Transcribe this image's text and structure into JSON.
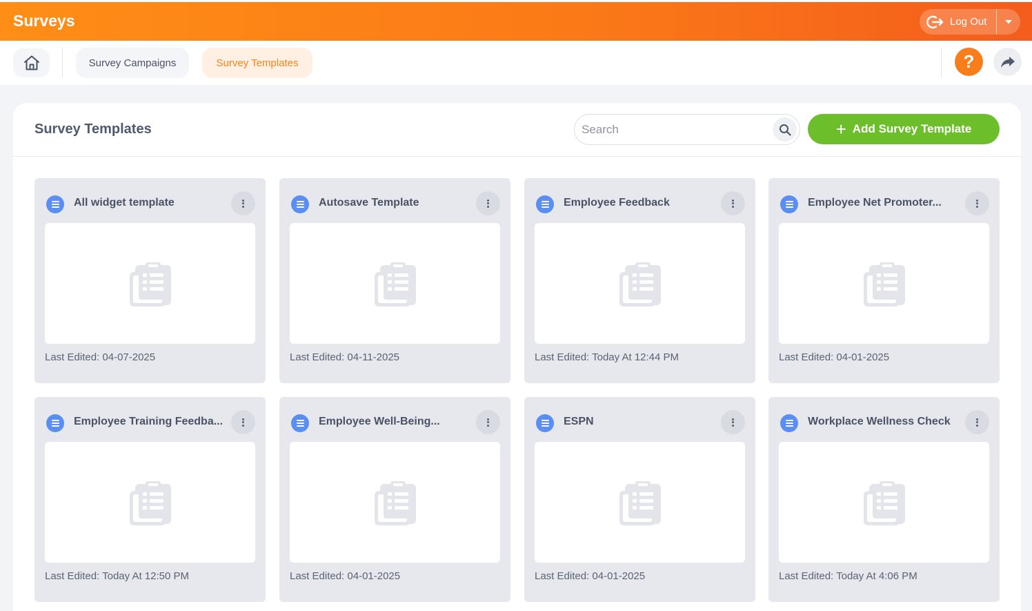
{
  "app": {
    "title": "Surveys",
    "logout_label": "Log Out",
    "icons": {
      "logout": "logout-icon",
      "caret": "caret-down-icon",
      "home": "home-icon",
      "help": "help-icon",
      "share": "share-icon",
      "search": "search-icon",
      "add": "plus-icon"
    },
    "colors": {
      "header_start": "#fe8e16",
      "header_end": "#f45d1c",
      "accent": "#f87e1c",
      "add_button": "#6cbf2b",
      "card_icon": "#5a8ef3"
    }
  },
  "nav": {
    "tabs": [
      {
        "label": "Survey Campaigns",
        "active": false
      },
      {
        "label": "Survey Templates",
        "active": true
      }
    ],
    "help_label": "?"
  },
  "main": {
    "title": "Survey Templates",
    "search_placeholder": "Search",
    "search_value": "",
    "add_label": "Add Survey Template"
  },
  "templates": [
    {
      "title": "All widget template",
      "last_edited": "Last Edited: 04-07-2025"
    },
    {
      "title": "Autosave Template",
      "last_edited": "Last Edited: 04-11-2025"
    },
    {
      "title": "Employee Feedback",
      "last_edited": "Last Edited: Today At 12:44 PM"
    },
    {
      "title": "Employee Net Promoter...",
      "last_edited": "Last Edited: 04-01-2025"
    },
    {
      "title": "Employee Training Feedba...",
      "last_edited": "Last Edited: Today At 12:50 PM"
    },
    {
      "title": "Employee Well-Being...",
      "last_edited": "Last Edited: 04-01-2025"
    },
    {
      "title": "ESPN",
      "last_edited": "Last Edited: 04-01-2025"
    },
    {
      "title": "Workplace Wellness Check",
      "last_edited": "Last Edited: Today At 4:06 PM"
    }
  ]
}
